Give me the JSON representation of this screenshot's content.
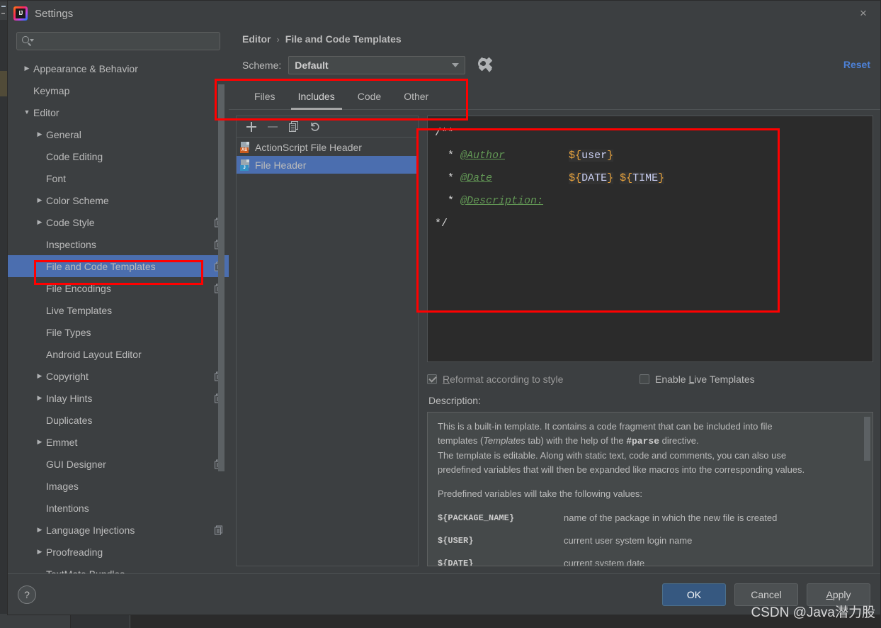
{
  "window": {
    "title": "Settings",
    "logo_text": "IJ",
    "close_icon": "×"
  },
  "sidebar": {
    "search_placeholder": "",
    "search_value": "",
    "search_icon": "search-icon",
    "items": [
      {
        "label": "Appearance & Behavior",
        "indent": 0,
        "arrow": "▶",
        "expandable": true,
        "selected": false,
        "copy": false
      },
      {
        "label": "Keymap",
        "indent": 0,
        "arrow": "",
        "expandable": false,
        "selected": false,
        "copy": false
      },
      {
        "label": "Editor",
        "indent": 0,
        "arrow": "▼",
        "expandable": true,
        "selected": false,
        "copy": false
      },
      {
        "label": "General",
        "indent": 1,
        "arrow": "▶",
        "expandable": true,
        "selected": false,
        "copy": false
      },
      {
        "label": "Code Editing",
        "indent": 1,
        "arrow": "",
        "expandable": false,
        "selected": false,
        "copy": false
      },
      {
        "label": "Font",
        "indent": 1,
        "arrow": "",
        "expandable": false,
        "selected": false,
        "copy": false
      },
      {
        "label": "Color Scheme",
        "indent": 1,
        "arrow": "▶",
        "expandable": true,
        "selected": false,
        "copy": false
      },
      {
        "label": "Code Style",
        "indent": 1,
        "arrow": "▶",
        "expandable": true,
        "selected": false,
        "copy": true
      },
      {
        "label": "Inspections",
        "indent": 1,
        "arrow": "",
        "expandable": false,
        "selected": false,
        "copy": true
      },
      {
        "label": "File and Code Templates",
        "indent": 1,
        "arrow": "",
        "expandable": false,
        "selected": true,
        "copy": true
      },
      {
        "label": "File Encodings",
        "indent": 1,
        "arrow": "",
        "expandable": false,
        "selected": false,
        "copy": true
      },
      {
        "label": "Live Templates",
        "indent": 1,
        "arrow": "",
        "expandable": false,
        "selected": false,
        "copy": false
      },
      {
        "label": "File Types",
        "indent": 1,
        "arrow": "",
        "expandable": false,
        "selected": false,
        "copy": false
      },
      {
        "label": "Android Layout Editor",
        "indent": 1,
        "arrow": "",
        "expandable": false,
        "selected": false,
        "copy": false
      },
      {
        "label": "Copyright",
        "indent": 1,
        "arrow": "▶",
        "expandable": true,
        "selected": false,
        "copy": true
      },
      {
        "label": "Inlay Hints",
        "indent": 1,
        "arrow": "▶",
        "expandable": true,
        "selected": false,
        "copy": true
      },
      {
        "label": "Duplicates",
        "indent": 1,
        "arrow": "",
        "expandable": false,
        "selected": false,
        "copy": false
      },
      {
        "label": "Emmet",
        "indent": 1,
        "arrow": "▶",
        "expandable": true,
        "selected": false,
        "copy": false
      },
      {
        "label": "GUI Designer",
        "indent": 1,
        "arrow": "",
        "expandable": false,
        "selected": false,
        "copy": true
      },
      {
        "label": "Images",
        "indent": 1,
        "arrow": "",
        "expandable": false,
        "selected": false,
        "copy": false
      },
      {
        "label": "Intentions",
        "indent": 1,
        "arrow": "",
        "expandable": false,
        "selected": false,
        "copy": false
      },
      {
        "label": "Language Injections",
        "indent": 1,
        "arrow": "▶",
        "expandable": true,
        "selected": false,
        "copy": true
      },
      {
        "label": "Proofreading",
        "indent": 1,
        "arrow": "▶",
        "expandable": true,
        "selected": false,
        "copy": false
      },
      {
        "label": "TextMate Bundles",
        "indent": 1,
        "arrow": "",
        "expandable": false,
        "selected": false,
        "copy": false
      }
    ]
  },
  "content": {
    "breadcrumb": {
      "parent": "Editor",
      "separator": "›",
      "current": "File and Code Templates"
    },
    "reset_label": "Reset",
    "scheme": {
      "label": "Scheme:",
      "value": "Default",
      "gear_icon": "gear-icon",
      "caret_icon": "chevron-down-icon"
    },
    "tabs": [
      {
        "label": "Files",
        "active": false
      },
      {
        "label": "Includes",
        "active": true
      },
      {
        "label": "Code",
        "active": false
      },
      {
        "label": "Other",
        "active": false
      }
    ],
    "list_toolbar": [
      {
        "name": "add-template-button",
        "icon": "plus-icon",
        "enabled": true
      },
      {
        "name": "remove-template-button",
        "icon": "minus-icon",
        "enabled": false
      },
      {
        "name": "copy-template-button",
        "icon": "copy-icon",
        "enabled": true
      },
      {
        "name": "reset-template-button",
        "icon": "undo-icon",
        "enabled": true
      }
    ],
    "templates": [
      {
        "label": "ActionScript File Header",
        "badge": "AS",
        "badge_color": "#cc5b1f",
        "selected": false
      },
      {
        "label": "File Header",
        "badge": "J",
        "badge_color": "#3592c4",
        "selected": true
      }
    ],
    "code": {
      "lines": [
        [
          {
            "text": "/**",
            "style": "comment"
          }
        ],
        [
          {
            "text": "  * ",
            "style": "comment"
          },
          {
            "text": "@Author",
            "style": "tag"
          },
          {
            "text": "          ",
            "style": "comment"
          },
          {
            "text": "${",
            "style": "var-brace"
          },
          {
            "text": "user",
            "style": "var-name"
          },
          {
            "text": "}",
            "style": "var-brace"
          }
        ],
        [
          {
            "text": "  * ",
            "style": "comment"
          },
          {
            "text": "@Date",
            "style": "tag"
          },
          {
            "text": "            ",
            "style": "comment"
          },
          {
            "text": "${",
            "style": "var-brace"
          },
          {
            "text": "DATE",
            "style": "var-name"
          },
          {
            "text": "}",
            "style": "var-brace"
          },
          {
            "text": " ",
            "style": "comment"
          },
          {
            "text": "${",
            "style": "var-brace"
          },
          {
            "text": "TIME",
            "style": "var-name"
          },
          {
            "text": "}",
            "style": "var-brace"
          }
        ],
        [
          {
            "text": "  * ",
            "style": "comment"
          },
          {
            "text": "@Description:",
            "style": "tag"
          }
        ],
        [
          {
            "text": "*/",
            "style": "comment"
          }
        ]
      ]
    },
    "checkboxes": [
      {
        "label_pre": "",
        "label_underline": "R",
        "label_post": "eformat according to style",
        "checked": true,
        "enabled": false
      },
      {
        "label_pre": "Enable ",
        "label_underline": "L",
        "label_post": "ive Templates",
        "checked": false,
        "enabled": true
      }
    ],
    "description_label": "Description:",
    "description": {
      "paragraphs": [
        "This is a built-in template. It contains a code fragment that can be included into file",
        "templates (Templates tab) with the help of the #parse directive.",
        "The template is editable. Along with static text, code and comments, you can also use",
        "predefined variables that will then be expanded like macros into the corresponding values."
      ],
      "p1_prefix": "templates (",
      "p1_italic": "Templates",
      "p1_mid": " tab) with the help of the ",
      "p1_bold": "#parse",
      "p1_suffix": " directive.",
      "variables_intro": "Predefined variables will take the following values:",
      "variables": [
        {
          "name": "${PACKAGE_NAME}",
          "desc": "name of the package in which the new file is created"
        },
        {
          "name": "${USER}",
          "desc": "current user system login name"
        },
        {
          "name": "${DATE}",
          "desc": "current system date"
        }
      ]
    }
  },
  "footer": {
    "help_icon": "?",
    "buttons": [
      {
        "label": "OK",
        "primary": true,
        "underline": ""
      },
      {
        "label": "Cancel",
        "primary": false,
        "underline": ""
      },
      {
        "label": "Apply",
        "primary": false,
        "underline": "A"
      }
    ]
  },
  "watermark": "CSDN @Java潜力股",
  "colors": {
    "dialog_bg": "#3c3f41",
    "selection_blue": "#4b6eaf",
    "primary_button": "#365880",
    "link_blue": "#4d81d7",
    "annotation_red": "#ff0000",
    "editor_bg": "#2b2b2b",
    "code_comment": "#d8d8d8",
    "code_tag": "#629755",
    "code_var_brace": "#e8a33d",
    "code_var_name": "#c8cdf0"
  }
}
